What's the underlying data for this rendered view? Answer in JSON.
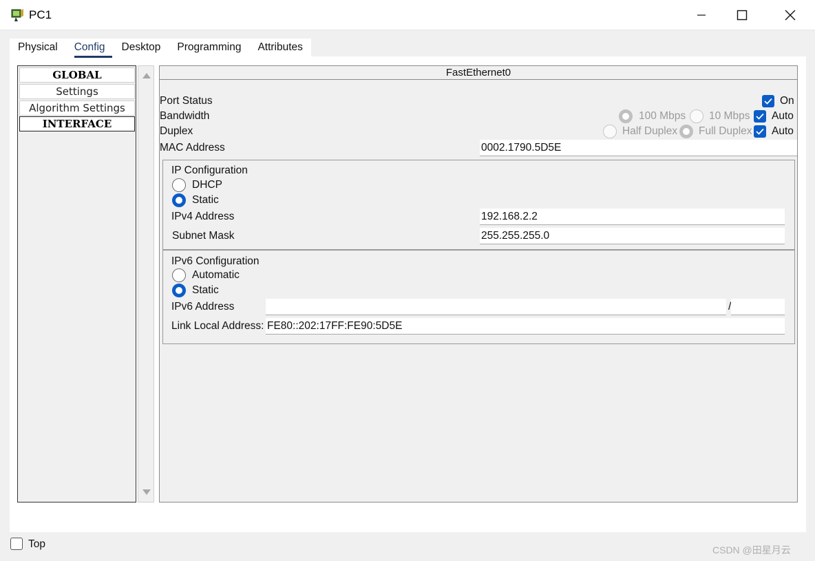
{
  "window": {
    "title": "PC1"
  },
  "tabs": [
    "Physical",
    "Config",
    "Desktop",
    "Programming",
    "Attributes"
  ],
  "sidebar": {
    "items": [
      {
        "label": "GLOBAL"
      },
      {
        "label": "Settings"
      },
      {
        "label": "Algorithm Settings"
      },
      {
        "label": "INTERFACE"
      }
    ]
  },
  "interface": {
    "title": "FastEthernet0",
    "port_status": {
      "label": "Port Status",
      "on_label": "On"
    },
    "bandwidth": {
      "label": "Bandwidth",
      "opt100": "100 Mbps",
      "opt10": "10 Mbps",
      "auto": "Auto"
    },
    "duplex": {
      "label": "Duplex",
      "half": "Half Duplex",
      "full": "Full Duplex",
      "auto": "Auto"
    },
    "mac": {
      "label": "MAC Address",
      "value": "0002.1790.5D5E"
    }
  },
  "ipv4": {
    "title": "IP Configuration",
    "dhcp": "DHCP",
    "static": "Static",
    "address_label": "IPv4 Address",
    "address": "192.168.2.2",
    "mask_label": "Subnet Mask",
    "mask": "255.255.255.0"
  },
  "ipv6": {
    "title": "IPv6 Configuration",
    "automatic": "Automatic",
    "static": "Static",
    "address_label": "IPv6 Address",
    "address": "",
    "slash": "/",
    "prefix": "",
    "link_local_label": "Link Local Address:",
    "link_local": "FE80::202:17FF:FE90:5D5E"
  },
  "footer": {
    "top_label": "Top"
  },
  "watermark": "CSDN @田星月云",
  "colors": {
    "accent": "#0b5cc7",
    "tab_underline": "#1f3a66"
  }
}
